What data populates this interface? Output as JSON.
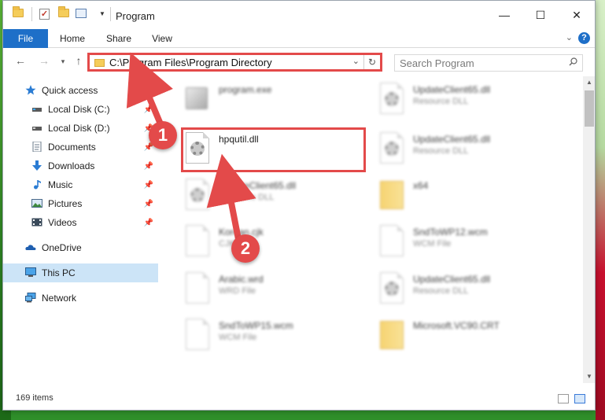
{
  "window": {
    "title": "Program"
  },
  "ribbon": {
    "tabs": [
      "File",
      "Home",
      "Share",
      "View"
    ]
  },
  "address": {
    "path": "C:\\Program Files\\Program Directory"
  },
  "search": {
    "placeholder": "Search Program"
  },
  "sidebar": {
    "items": [
      {
        "label": "Quick access",
        "icon": "star-icon",
        "pinned": false
      },
      {
        "label": "Local Disk (C:)",
        "icon": "drive-icon",
        "pinned": true
      },
      {
        "label": "Local Disk (D:)",
        "icon": "drive-icon",
        "pinned": true
      },
      {
        "label": "Documents",
        "icon": "documents-icon",
        "pinned": true
      },
      {
        "label": "Downloads",
        "icon": "downloads-icon",
        "pinned": true
      },
      {
        "label": "Music",
        "icon": "music-icon",
        "pinned": true
      },
      {
        "label": "Pictures",
        "icon": "pictures-icon",
        "pinned": true
      },
      {
        "label": "Videos",
        "icon": "videos-icon",
        "pinned": true
      },
      {
        "label": "OneDrive",
        "icon": "onedrive-icon",
        "pinned": false
      },
      {
        "label": "This PC",
        "icon": "pc-icon",
        "pinned": false,
        "selected": true
      },
      {
        "label": "Network",
        "icon": "network-icon",
        "pinned": false
      }
    ]
  },
  "files": [
    {
      "name": "program.exe",
      "type": "",
      "icon": "exe-icon",
      "blurred": true
    },
    {
      "name": "UpdateClient65.dll",
      "type": "Resource DLL",
      "icon": "dll-icon",
      "blurred": true
    },
    {
      "name": "hpqutil.dll",
      "type": "",
      "icon": "dll-icon",
      "blurred": false,
      "highlighted": true
    },
    {
      "name": "UpdateClient65.dll",
      "type": "Resource DLL",
      "icon": "dll-icon",
      "blurred": true
    },
    {
      "name": "UpdateClient65.dll",
      "type": "Resource DLL",
      "icon": "dll-icon",
      "blurred": true
    },
    {
      "name": "x64",
      "type": "",
      "icon": "folder-icon",
      "blurred": true
    },
    {
      "name": "Korean.cjk",
      "type": "CJK File",
      "icon": "file-icon",
      "blurred": true
    },
    {
      "name": "SndToWP12.wcm",
      "type": "WCM File",
      "icon": "file-icon",
      "blurred": true
    },
    {
      "name": "Arabic.wrd",
      "type": "WRD File",
      "icon": "file-icon",
      "blurred": true
    },
    {
      "name": "UpdateClient65.dll",
      "type": "Resource DLL",
      "icon": "dll-icon",
      "blurred": true
    },
    {
      "name": "SndToWP15.wcm",
      "type": "WCM File",
      "icon": "file-icon",
      "blurred": true
    },
    {
      "name": "Microsoft.VC90.CRT",
      "type": "",
      "icon": "folder-icon",
      "blurred": true
    }
  ],
  "status": {
    "item_count": "169 items"
  },
  "annotations": {
    "step1": "1",
    "step2": "2"
  },
  "colors": {
    "accent": "#1e6fc8",
    "annotation": "#e34a4a",
    "selected": "#cce4f7"
  }
}
